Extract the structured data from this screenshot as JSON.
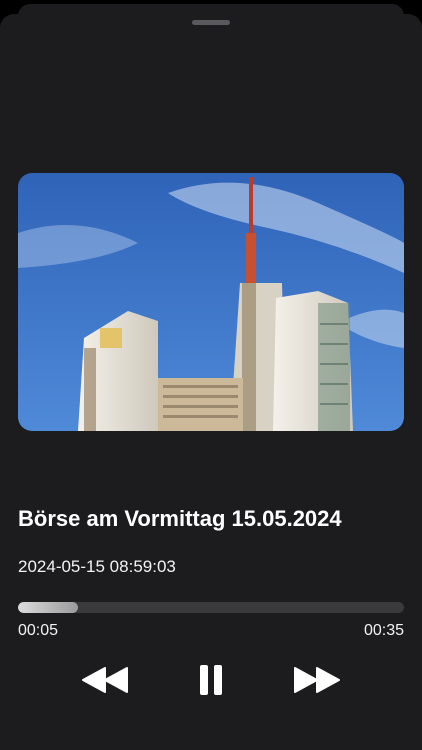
{
  "player": {
    "title": "Börse am Vormittag 15.05.2024",
    "datetime": "2024-05-15 08:59:03",
    "elapsed": "00:05",
    "duration": "00:35",
    "progress_fraction": 0.155
  },
  "colors": {
    "background": "#000000",
    "sheet": "#1c1c1e",
    "track": "#3a3a3c",
    "text": "#ffffff"
  },
  "icons": {
    "rewind": "backward-icon",
    "pause": "pause-icon",
    "forward": "forward-icon"
  }
}
